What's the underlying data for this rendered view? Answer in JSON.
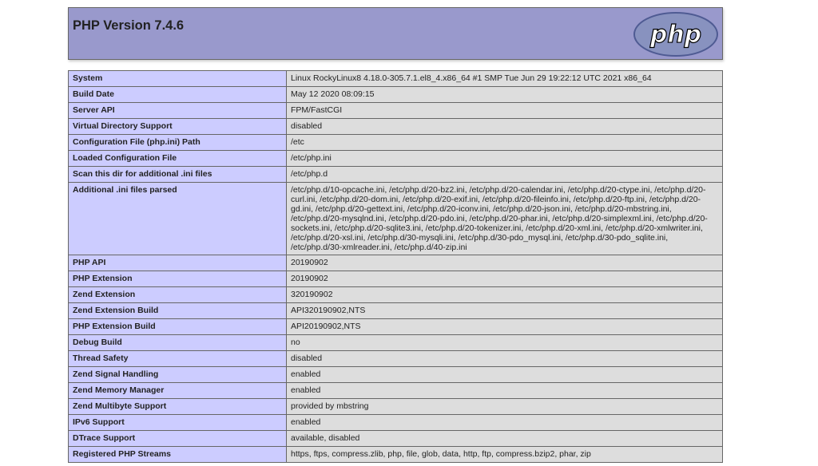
{
  "header": {
    "title": "PHP Version 7.4.6",
    "logo_text": "php"
  },
  "rows": [
    {
      "key": "System",
      "value": "Linux RockyLinux8 4.18.0-305.7.1.el8_4.x86_64 #1 SMP Tue Jun 29 19:22:12 UTC 2021 x86_64"
    },
    {
      "key": "Build Date",
      "value": "May 12 2020 08:09:15"
    },
    {
      "key": "Server API",
      "value": "FPM/FastCGI"
    },
    {
      "key": "Virtual Directory Support",
      "value": "disabled"
    },
    {
      "key": "Configuration File (php.ini) Path",
      "value": "/etc"
    },
    {
      "key": "Loaded Configuration File",
      "value": "/etc/php.ini"
    },
    {
      "key": "Scan this dir for additional .ini files",
      "value": "/etc/php.d"
    },
    {
      "key": "Additional .ini files parsed",
      "value": "/etc/php.d/10-opcache.ini, /etc/php.d/20-bz2.ini, /etc/php.d/20-calendar.ini, /etc/php.d/20-ctype.ini, /etc/php.d/20-curl.ini, /etc/php.d/20-dom.ini, /etc/php.d/20-exif.ini, /etc/php.d/20-fileinfo.ini, /etc/php.d/20-ftp.ini, /etc/php.d/20-gd.ini, /etc/php.d/20-gettext.ini, /etc/php.d/20-iconv.ini, /etc/php.d/20-json.ini, /etc/php.d/20-mbstring.ini, /etc/php.d/20-mysqlnd.ini, /etc/php.d/20-pdo.ini, /etc/php.d/20-phar.ini, /etc/php.d/20-simplexml.ini, /etc/php.d/20-sockets.ini, /etc/php.d/20-sqlite3.ini, /etc/php.d/20-tokenizer.ini, /etc/php.d/20-xml.ini, /etc/php.d/20-xmlwriter.ini, /etc/php.d/20-xsl.ini, /etc/php.d/30-mysqli.ini, /etc/php.d/30-pdo_mysql.ini, /etc/php.d/30-pdo_sqlite.ini, /etc/php.d/30-xmlreader.ini, /etc/php.d/40-zip.ini"
    },
    {
      "key": "PHP API",
      "value": "20190902"
    },
    {
      "key": "PHP Extension",
      "value": "20190902"
    },
    {
      "key": "Zend Extension",
      "value": "320190902"
    },
    {
      "key": "Zend Extension Build",
      "value": "API320190902,NTS"
    },
    {
      "key": "PHP Extension Build",
      "value": "API20190902,NTS"
    },
    {
      "key": "Debug Build",
      "value": "no"
    },
    {
      "key": "Thread Safety",
      "value": "disabled"
    },
    {
      "key": "Zend Signal Handling",
      "value": "enabled"
    },
    {
      "key": "Zend Memory Manager",
      "value": "enabled"
    },
    {
      "key": "Zend Multibyte Support",
      "value": "provided by mbstring"
    },
    {
      "key": "IPv6 Support",
      "value": "enabled"
    },
    {
      "key": "DTrace Support",
      "value": "available, disabled"
    },
    {
      "key": "Registered PHP Streams",
      "value": "https, ftps, compress.zlib, php, file, glob, data, http, ftp, compress.bzip2, phar, zip"
    }
  ],
  "colors": {
    "header_bg": "#9999cc",
    "key_bg": "#ccccff",
    "value_bg": "#dddddd",
    "logo_bg": "#8892bf",
    "border": "#666666"
  }
}
